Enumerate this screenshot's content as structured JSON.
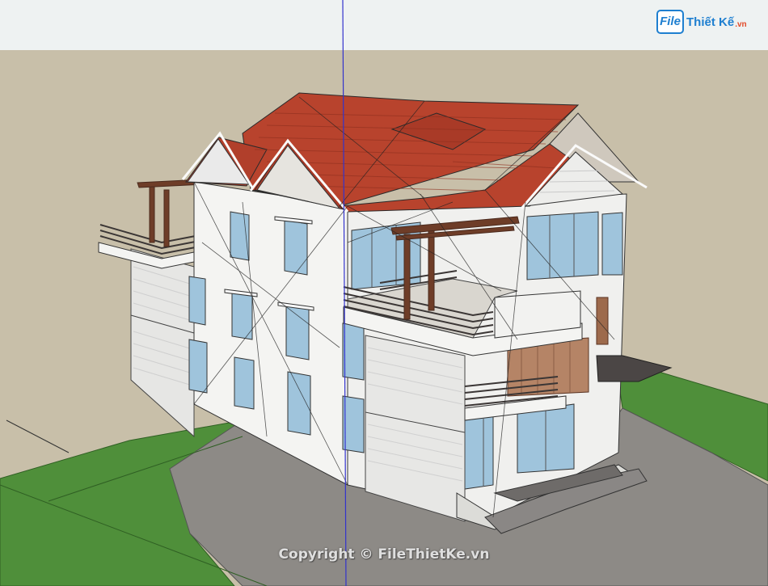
{
  "logo": {
    "mark": "File",
    "name": "Thiết Kế",
    "tld": ".vn"
  },
  "watermark": "Copyright © FileThietKe.vn",
  "colors": {
    "sky": "#eef2f2",
    "ground": "#c8bfa9",
    "lawn": "#4f8f3a",
    "paving": "#8d8a86",
    "roof": "#b8432d",
    "wall": "#f4f4f2",
    "glass": "#9fc4dc",
    "rail": "#3b3635",
    "timber": "#6e3d28",
    "axis_blue": "#3333cc"
  },
  "icons": {
    "logo": "filethietke-logo-icon"
  }
}
